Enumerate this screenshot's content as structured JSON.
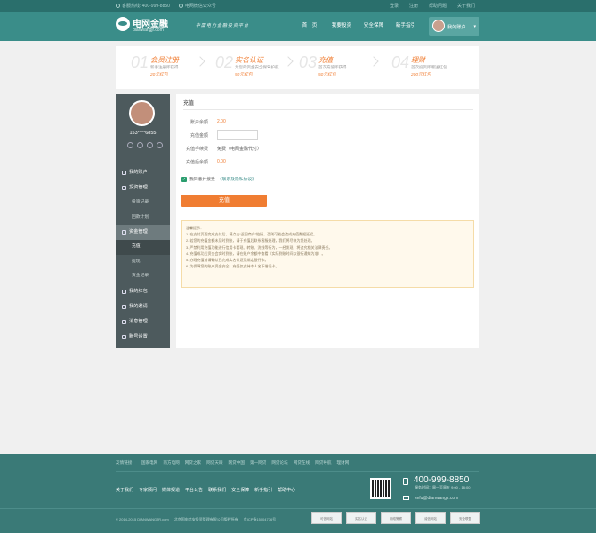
{
  "topbar": {
    "phone": "客服热线: 400-999-8850",
    "wechat": "电网微信公众号",
    "links": [
      "登录",
      "注册",
      "帮助问题",
      "关于我们"
    ]
  },
  "header": {
    "logo_cn": "电网金融",
    "logo_en": "dianwangjr.com",
    "slogan": "中国电力金融投资平台",
    "nav": [
      "首　页",
      "我要投资",
      "安全保障",
      "新手指引"
    ],
    "account_label": "我的账户"
  },
  "steps": [
    {
      "num": "01",
      "title": "会员注册",
      "desc": "新手注册即获得",
      "reward": "20元红包"
    },
    {
      "num": "02",
      "title": "实名认证",
      "desc": "为您的资金安全保驾护航",
      "reward": "50元红包"
    },
    {
      "num": "03",
      "title": "充值",
      "desc": "首次充值即获得",
      "reward": "50元红包"
    },
    {
      "num": "04",
      "title": "理财",
      "desc": "首次投资即赠送红包",
      "reward": "200元红包"
    }
  ],
  "sidebar": {
    "username": "153****6855",
    "menu": [
      {
        "label": "我的账户",
        "icon": "user-icon"
      },
      {
        "label": "投资管理",
        "icon": "invest-icon",
        "subs": [
          "投资记录",
          "回款计划"
        ]
      },
      {
        "label": "资金管理",
        "icon": "fund-icon",
        "subs": [
          "充值",
          "提现",
          "资金记录"
        ]
      },
      {
        "label": "我的红包",
        "icon": "redpacket-icon"
      },
      {
        "label": "我的邀请",
        "icon": "invite-icon"
      },
      {
        "label": "消息管理",
        "icon": "message-icon"
      },
      {
        "label": "账号设置",
        "icon": "settings-icon"
      }
    ]
  },
  "main": {
    "title": "充值",
    "balance_label": "账户余额",
    "balance_value": "2.00",
    "amount_label": "充值金额",
    "amount_value": "",
    "fee_label": "充值手续费",
    "fee_value": "免费（电网金融代付）",
    "after_label": "充值后余额",
    "after_value": "0.00",
    "agree_text": "我同意并接受",
    "agree_link": "《联系及隐私协议》",
    "pay_button": "充值",
    "tips": [
      "温馨提示：",
      "1. 在支付页面完成支付后，请点击“返回商户”链接，否则可能会造成充值数据延迟。",
      "2. 若您的充值金额未及时到账，请于充值后联系客服处理，我们将尽快为您处理。",
      "3. 严禁利用充值功能进行信用卡套现、转账、洗钱等行为，一经发现，将追究相关法律责任。",
      "4. 充值成功后资金会实时到账，请在账户余额中查看（实际到账时间以银行通知为准）。",
      "5. 办理充值前请确认已完成实名认证及绑定银行卡。",
      "6. 为保障您的账户资金安全，充值仅支持本人名下借记卡。"
    ]
  },
  "footer": {
    "links": [
      "友情链接：",
      "国家电网",
      "南方电网",
      "网贷之家",
      "网贷天眼",
      "网贷中国",
      "第一网贷",
      "网贷论坛",
      "网贷在线",
      "网贷导航",
      "理财网"
    ],
    "nav": [
      "关于我们",
      "专家顾问",
      "媒体报道",
      "平台公告",
      "联系我们",
      "安全保障",
      "新手指引",
      "帮助中心"
    ],
    "phone": "400-999-8850",
    "worktime": "服务时间：周一至周五 9:00 - 18:00",
    "email": "kefu@dianwangjr.com",
    "copyright": "© 2014-2015 DIANWANGJR.com",
    "company": "北京国电信安投资管理有限公司版权所有",
    "icp": "京ICP备15004776号",
    "certs": [
      "可信网站",
      "实名认证",
      "网络警察",
      "诚信网站",
      "安全联盟"
    ]
  }
}
